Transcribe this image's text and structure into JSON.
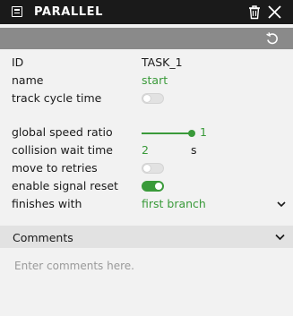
{
  "window": {
    "title": "PARALLEL",
    "icons": {
      "panel": "panel-list-icon",
      "delete": "trash-icon",
      "close": "close-icon",
      "refresh": "refresh-icon"
    }
  },
  "properties": {
    "id": {
      "label": "ID",
      "value": "TASK_1"
    },
    "name": {
      "label": "name",
      "value": "start"
    },
    "track_cycle_time": {
      "label": "track cycle time",
      "enabled": false
    },
    "global_speed_ratio": {
      "label": "global speed ratio",
      "value": "1",
      "fill_fraction": 1.0
    },
    "collision_wait_time": {
      "label": "collision wait time",
      "value": "2",
      "unit": "s"
    },
    "move_to_retries": {
      "label": "move to retries",
      "enabled": false
    },
    "enable_signal_reset": {
      "label": "enable signal reset",
      "enabled": true
    },
    "finishes_with": {
      "label": "finishes with",
      "value": "first branch"
    }
  },
  "comments": {
    "header": "Comments",
    "placeholder": "Enter comments here.",
    "value": ""
  },
  "colors": {
    "accent_green": "#3a9a3a",
    "titlebar_bg": "#1a1a1a",
    "toolbar_bg": "#8a8a8a",
    "panel_bg": "#f2f2f2"
  }
}
